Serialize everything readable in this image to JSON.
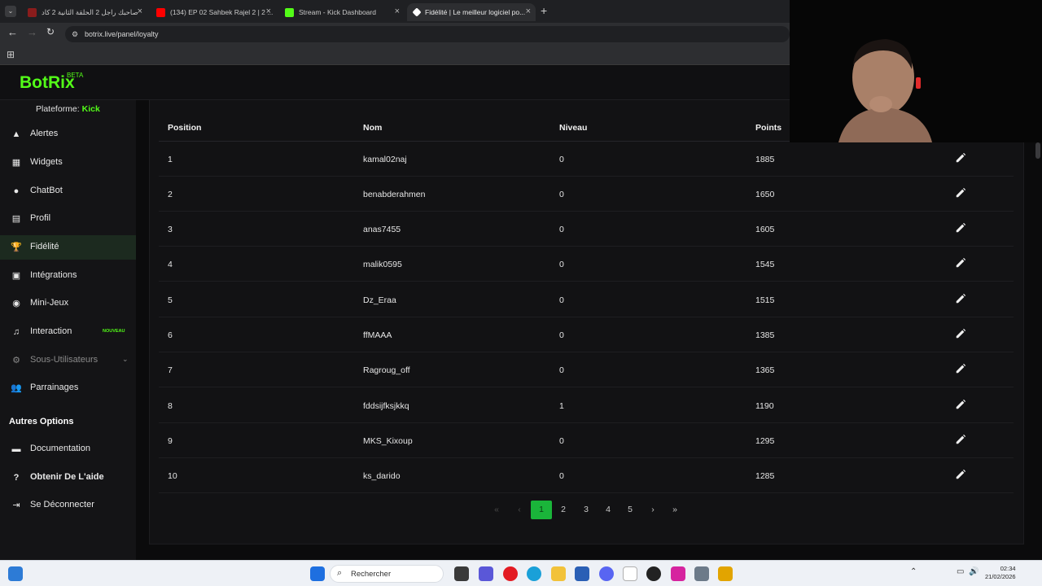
{
  "browser": {
    "tabs": [
      {
        "title": "صاحبك راجل 2 الحلقة الثانية 2 كاد",
        "favicon_color": "#8a1c1c"
      },
      {
        "title": "(134) EP 02 Sahbek Rajel 2 | 2 ...",
        "favicon_color": "#ff0000"
      },
      {
        "title": "Stream - Kick Dashboard",
        "favicon_color": "#53fc18"
      },
      {
        "title": "Fidélité | Le meilleur logiciel po...",
        "favicon_color": "#ffffff"
      }
    ],
    "url": "botrix.live/panel/loyalty"
  },
  "brand": {
    "name": "BotRix",
    "beta": "BETA",
    "accent": "#53fc18"
  },
  "sidebar": {
    "platform_label": "Plateforme: ",
    "platform_value": "Kick",
    "items": [
      {
        "label": "Alertes",
        "icon": "warning-icon"
      },
      {
        "label": "Widgets",
        "icon": "grid-icon"
      },
      {
        "label": "ChatBot",
        "icon": "robot-icon"
      },
      {
        "label": "Profil",
        "icon": "id-card-icon"
      },
      {
        "label": "Fidélité",
        "icon": "trophy-icon"
      },
      {
        "label": "Intégrations",
        "icon": "puzzle-icon"
      },
      {
        "label": "Mini-Jeux",
        "icon": "gamepad-icon"
      },
      {
        "label": "Interaction",
        "icon": "music-note-icon",
        "badge": "NOUVEAU"
      },
      {
        "label": "Sous-Utilisateurs",
        "icon": "users-cog-icon"
      },
      {
        "label": "Parrainages",
        "icon": "users-icon"
      }
    ],
    "other_options_heading": "Autres Options",
    "other_items": [
      {
        "label": "Documentation",
        "icon": "book-icon"
      },
      {
        "label": "Obtenir De L'aide",
        "icon": "help-circle-icon"
      },
      {
        "label": "Se Déconnecter",
        "icon": "logout-icon"
      }
    ]
  },
  "table": {
    "headers": [
      "Position",
      "Nom",
      "Niveau",
      "Points"
    ],
    "rows": [
      {
        "position": "1",
        "name": "kamal02naj",
        "level": "0",
        "points": "1885"
      },
      {
        "position": "2",
        "name": "benabderahmen",
        "level": "0",
        "points": "1650"
      },
      {
        "position": "3",
        "name": "anas7455",
        "level": "0",
        "points": "1605"
      },
      {
        "position": "4",
        "name": "malik0595",
        "level": "0",
        "points": "1545"
      },
      {
        "position": "5",
        "name": "Dz_Eraa",
        "level": "0",
        "points": "1515"
      },
      {
        "position": "6",
        "name": "ffMAAA",
        "level": "0",
        "points": "1385"
      },
      {
        "position": "7",
        "name": "Ragroug_off",
        "level": "0",
        "points": "1365"
      },
      {
        "position": "8",
        "name": "fddsijfksjkkq",
        "level": "1",
        "points": "1190"
      },
      {
        "position": "9",
        "name": "MKS_Kixoup",
        "level": "0",
        "points": "1295"
      },
      {
        "position": "10",
        "name": "ks_darido",
        "level": "0",
        "points": "1285"
      }
    ]
  },
  "pagination": {
    "pages": [
      "1",
      "2",
      "3",
      "4",
      "5"
    ],
    "current": "1"
  },
  "taskbar": {
    "search_placeholder": "Rechercher",
    "time": "02:34",
    "date": "21/02/2026"
  }
}
